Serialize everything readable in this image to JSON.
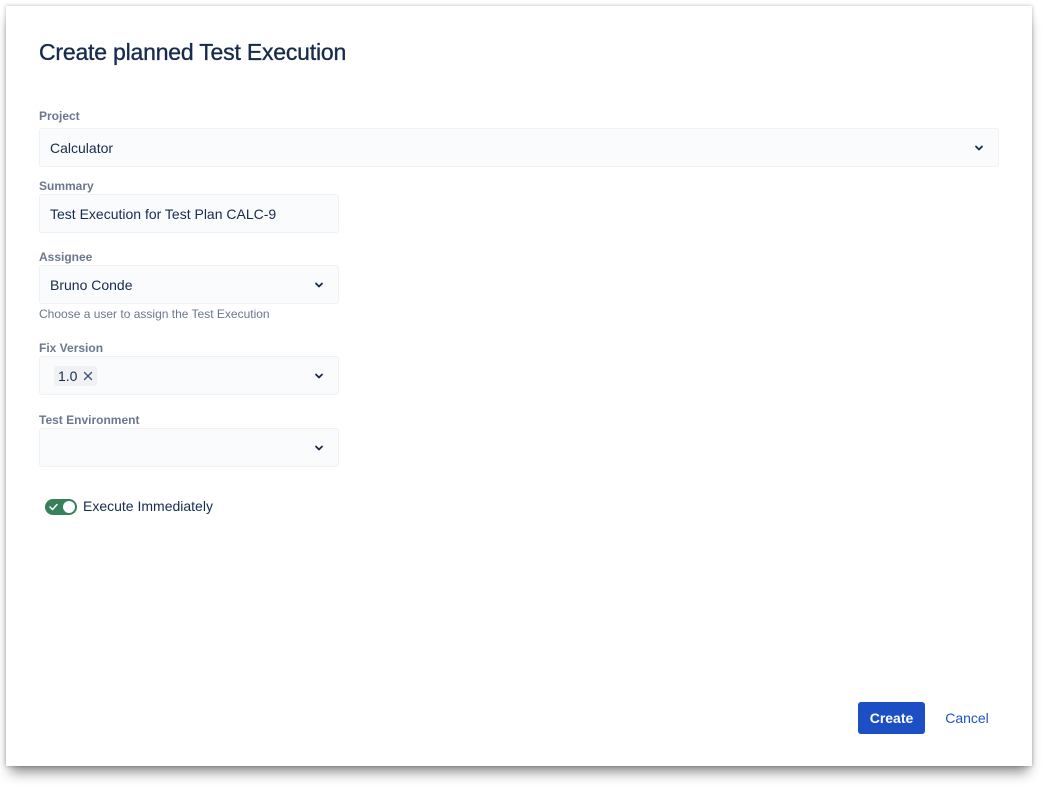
{
  "dialog": {
    "title": "Create planned Test Execution"
  },
  "fields": {
    "project": {
      "label": "Project",
      "value": "Calculator"
    },
    "summary": {
      "label": "Summary",
      "value": "Test Execution for Test Plan CALC-9"
    },
    "assignee": {
      "label": "Assignee",
      "value": "Bruno Conde",
      "helper": "Choose a user to assign the Test Execution"
    },
    "fix_version": {
      "label": "Fix Version",
      "tags": [
        "1.0"
      ]
    },
    "test_environment": {
      "label": "Test Environment",
      "value": ""
    }
  },
  "toggle": {
    "label": "Execute Immediately",
    "checked": true
  },
  "buttons": {
    "create": "Create",
    "cancel": "Cancel"
  },
  "icons": {
    "select_chevron": "chevron-down-icon",
    "tag_remove": "close-icon",
    "toggle_check": "check-icon"
  },
  "colors": {
    "primary": "#1d4fc4",
    "link": "#1d55c4",
    "toggle_on": "#36805a",
    "text": "#172b4d",
    "label": "#6b778c",
    "field_bg": "#fafbfc"
  }
}
